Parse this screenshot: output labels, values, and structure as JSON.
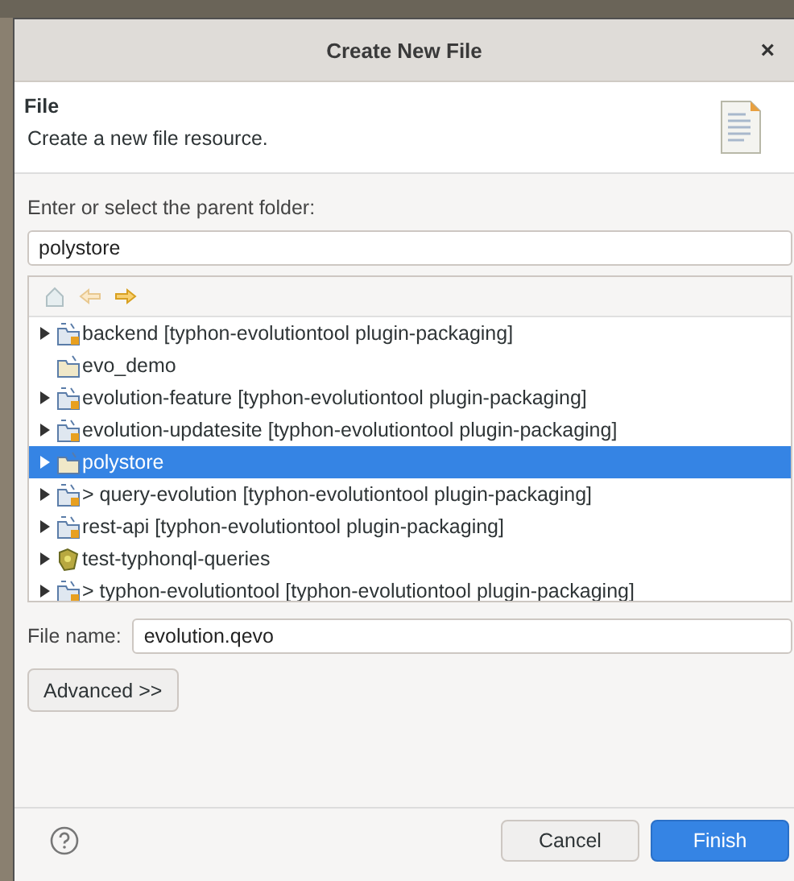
{
  "window": {
    "title": "Create New File",
    "close": "×"
  },
  "header": {
    "title": "File",
    "description": "Create a new file resource."
  },
  "folder_label": "Enter or select the parent folder:",
  "folder_field": {
    "value": "polystore"
  },
  "tree": {
    "items": [
      {
        "label": "backend [typhon-evolutiontool plugin-packaging]",
        "kind": "project",
        "expandable": true,
        "selected": false
      },
      {
        "label": "evo_demo",
        "kind": "folder",
        "expandable": false,
        "selected": false
      },
      {
        "label": "evolution-feature [typhon-evolutiontool plugin-packaging]",
        "kind": "project",
        "expandable": true,
        "selected": false
      },
      {
        "label": "evolution-updatesite [typhon-evolutiontool plugin-packaging]",
        "kind": "project",
        "expandable": true,
        "selected": false
      },
      {
        "label": "polystore",
        "kind": "folder",
        "expandable": true,
        "selected": true
      },
      {
        "label": "> query-evolution [typhon-evolutiontool plugin-packaging]",
        "kind": "project",
        "expandable": true,
        "selected": false
      },
      {
        "label": "rest-api [typhon-evolutiontool plugin-packaging]",
        "kind": "project",
        "expandable": true,
        "selected": false
      },
      {
        "label": "test-typhonql-queries",
        "kind": "plugin",
        "expandable": true,
        "selected": false
      },
      {
        "label": "> typhon-evolutiontool [typhon-evolutiontool plugin-packaging]",
        "kind": "project",
        "expandable": true,
        "selected": false
      }
    ]
  },
  "file_name": {
    "label": "File name:",
    "value": "evolution.qevo"
  },
  "advanced_button": "Advanced >>",
  "buttons": [
    {
      "label": "Cancel",
      "primary": false
    },
    {
      "label": "Finish",
      "primary": true
    }
  ]
}
